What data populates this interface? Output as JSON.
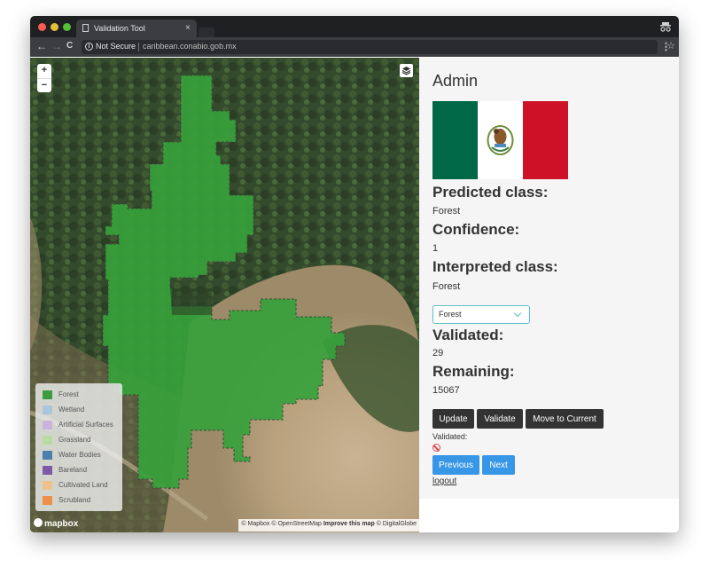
{
  "browser": {
    "tab_title": "Validation Tool",
    "tab_close": "×",
    "not_secure": "Not Secure",
    "url": "caribbean.conabio.gob.mx",
    "back": "←",
    "forward": "→",
    "reload": "C",
    "star": "☆",
    "menu": "⋮",
    "info": "i"
  },
  "map": {
    "zoom_in": "+",
    "zoom_out": "−",
    "legend": [
      {
        "label": "Forest",
        "color": "#3f9b3f"
      },
      {
        "label": "Wetland",
        "color": "#a9c6dc"
      },
      {
        "label": "Artificial Surfaces",
        "color": "#c9b4db"
      },
      {
        "label": "Grassland",
        "color": "#b7dba0"
      },
      {
        "label": "Water Bodies",
        "color": "#4d7fae"
      },
      {
        "label": "Bareland",
        "color": "#7b5ba8"
      },
      {
        "label": "Cultivated Land",
        "color": "#efc28c"
      },
      {
        "label": "Scrubland",
        "color": "#ec8f48"
      }
    ],
    "logo_text": "mapbox",
    "attribution": {
      "mapbox": "© Mapbox",
      "osm": "© OpenStreetMap",
      "improve": "Improve this map",
      "digitalglobe": "© DigitalGlobe"
    }
  },
  "panel": {
    "title": "Admin",
    "predicted_label": "Predicted class:",
    "predicted_value": "Forest",
    "confidence_label": "Confidence:",
    "confidence_value": "1",
    "interpreted_label": "Interpreted class:",
    "interpreted_value": "Forest",
    "select_value": "Forest",
    "validated_label": "Validated:",
    "validated_value": "29",
    "remaining_label": "Remaining:",
    "remaining_value": "15067",
    "buttons": {
      "update": "Update",
      "validate": "Validate",
      "move": "Move to Current",
      "previous": "Previous",
      "next": "Next"
    },
    "validated_status_label": "Validated:",
    "logout": "logout"
  },
  "colors": {
    "flag_green": "#006847",
    "flag_red": "#ce1126",
    "button_dark": "#333333",
    "button_blue": "#3796e6",
    "select_border": "#5bc0c6"
  }
}
